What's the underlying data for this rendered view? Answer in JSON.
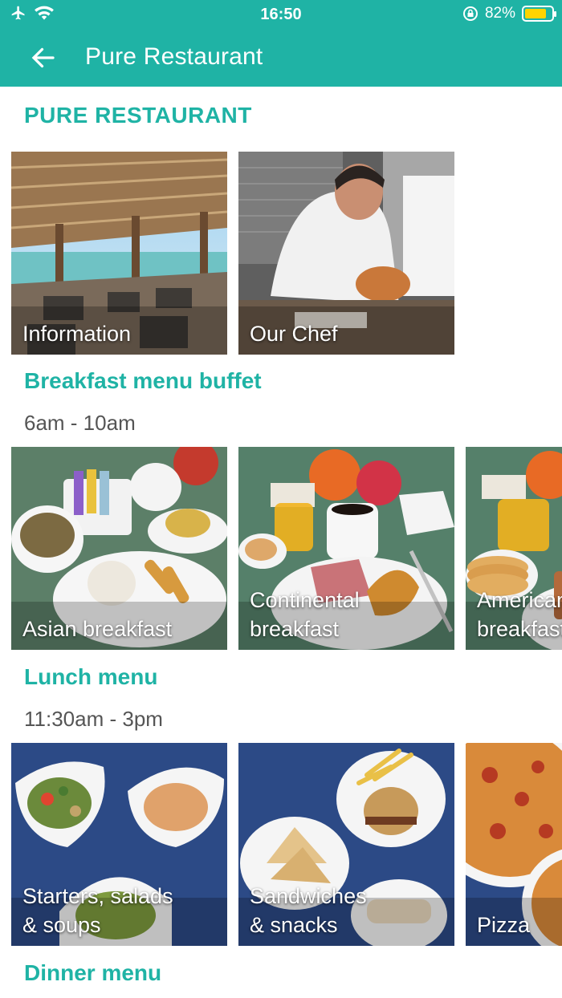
{
  "status": {
    "time": "16:50",
    "battery_text": "82%",
    "battery_level": 0.82
  },
  "app_bar": {
    "title": "Pure Restaurant"
  },
  "page_heading": "PURE RESTAURANT",
  "intro_tiles": [
    {
      "label": "Information"
    },
    {
      "label": "Our Chef"
    }
  ],
  "sections": [
    {
      "title": "Breakfast menu buffet",
      "hours": "6am - 10am",
      "tiles": [
        {
          "label": "Asian breakfast"
        },
        {
          "label": "Continental\nbreakfast"
        },
        {
          "label": "American\nbreakfast"
        }
      ]
    },
    {
      "title": "Lunch menu",
      "hours": "11:30am - 3pm",
      "tiles": [
        {
          "label": "Starters, salads\n& soups"
        },
        {
          "label": "Sandwiches\n& snacks"
        },
        {
          "label": "Pizza"
        }
      ]
    },
    {
      "title": "Dinner menu"
    }
  ],
  "colors": {
    "accent": "#1fb3a5",
    "battery": "#ffd400"
  }
}
